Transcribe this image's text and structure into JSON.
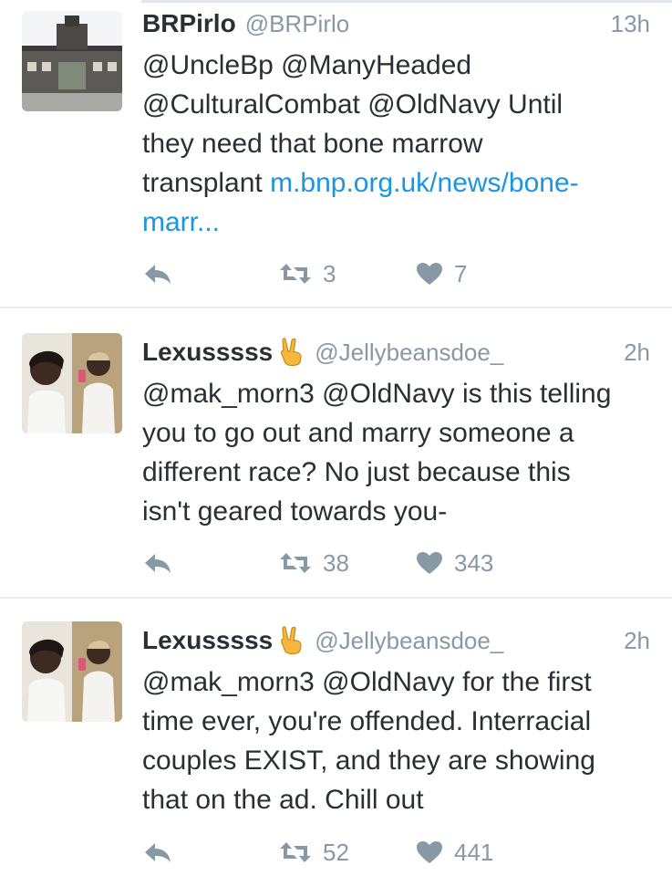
{
  "tweets": [
    {
      "name": "BRPirlo",
      "handle": "@BRPirlo",
      "time": "13h",
      "has_emoji": false,
      "text_lines": [
        "@UncleBp @ManyHeaded",
        "@CulturalCombat @OldNavy Until",
        "they need that bone marrow"
      ],
      "text_prefix": "transplant ",
      "link_part1": "m.bnp.org.uk/news/bone-",
      "link_part2": "marr...",
      "retweets": "3",
      "likes": "7"
    },
    {
      "name": "Lexusssss",
      "handle": "@Jellybeansdoe_",
      "time": "2h",
      "has_emoji": true,
      "text_lines": [
        "@mak_morn3 @OldNavy is this telling",
        "you to go out and marry someone a",
        "different race? No just because this",
        "isn't geared towards you-"
      ],
      "retweets": "38",
      "likes": "343"
    },
    {
      "name": "Lexusssss",
      "handle": "@Jellybeansdoe_",
      "time": "2h",
      "has_emoji": true,
      "text_lines": [
        "@mak_morn3 @OldNavy for the first",
        "time ever, you're offended. Interracial",
        "couples EXIST, and they are showing",
        "that on the ad. Chill out"
      ],
      "retweets": "52",
      "likes": "441"
    }
  ],
  "colors": {
    "name": "#292f33",
    "meta": "#8899a6",
    "link": "#1b95e0",
    "divider": "#e6ecf0"
  },
  "icons": {
    "reply": "reply-icon",
    "retweet": "retweet-icon",
    "like": "heart-icon",
    "emoji": "victory-hand-emoji"
  }
}
